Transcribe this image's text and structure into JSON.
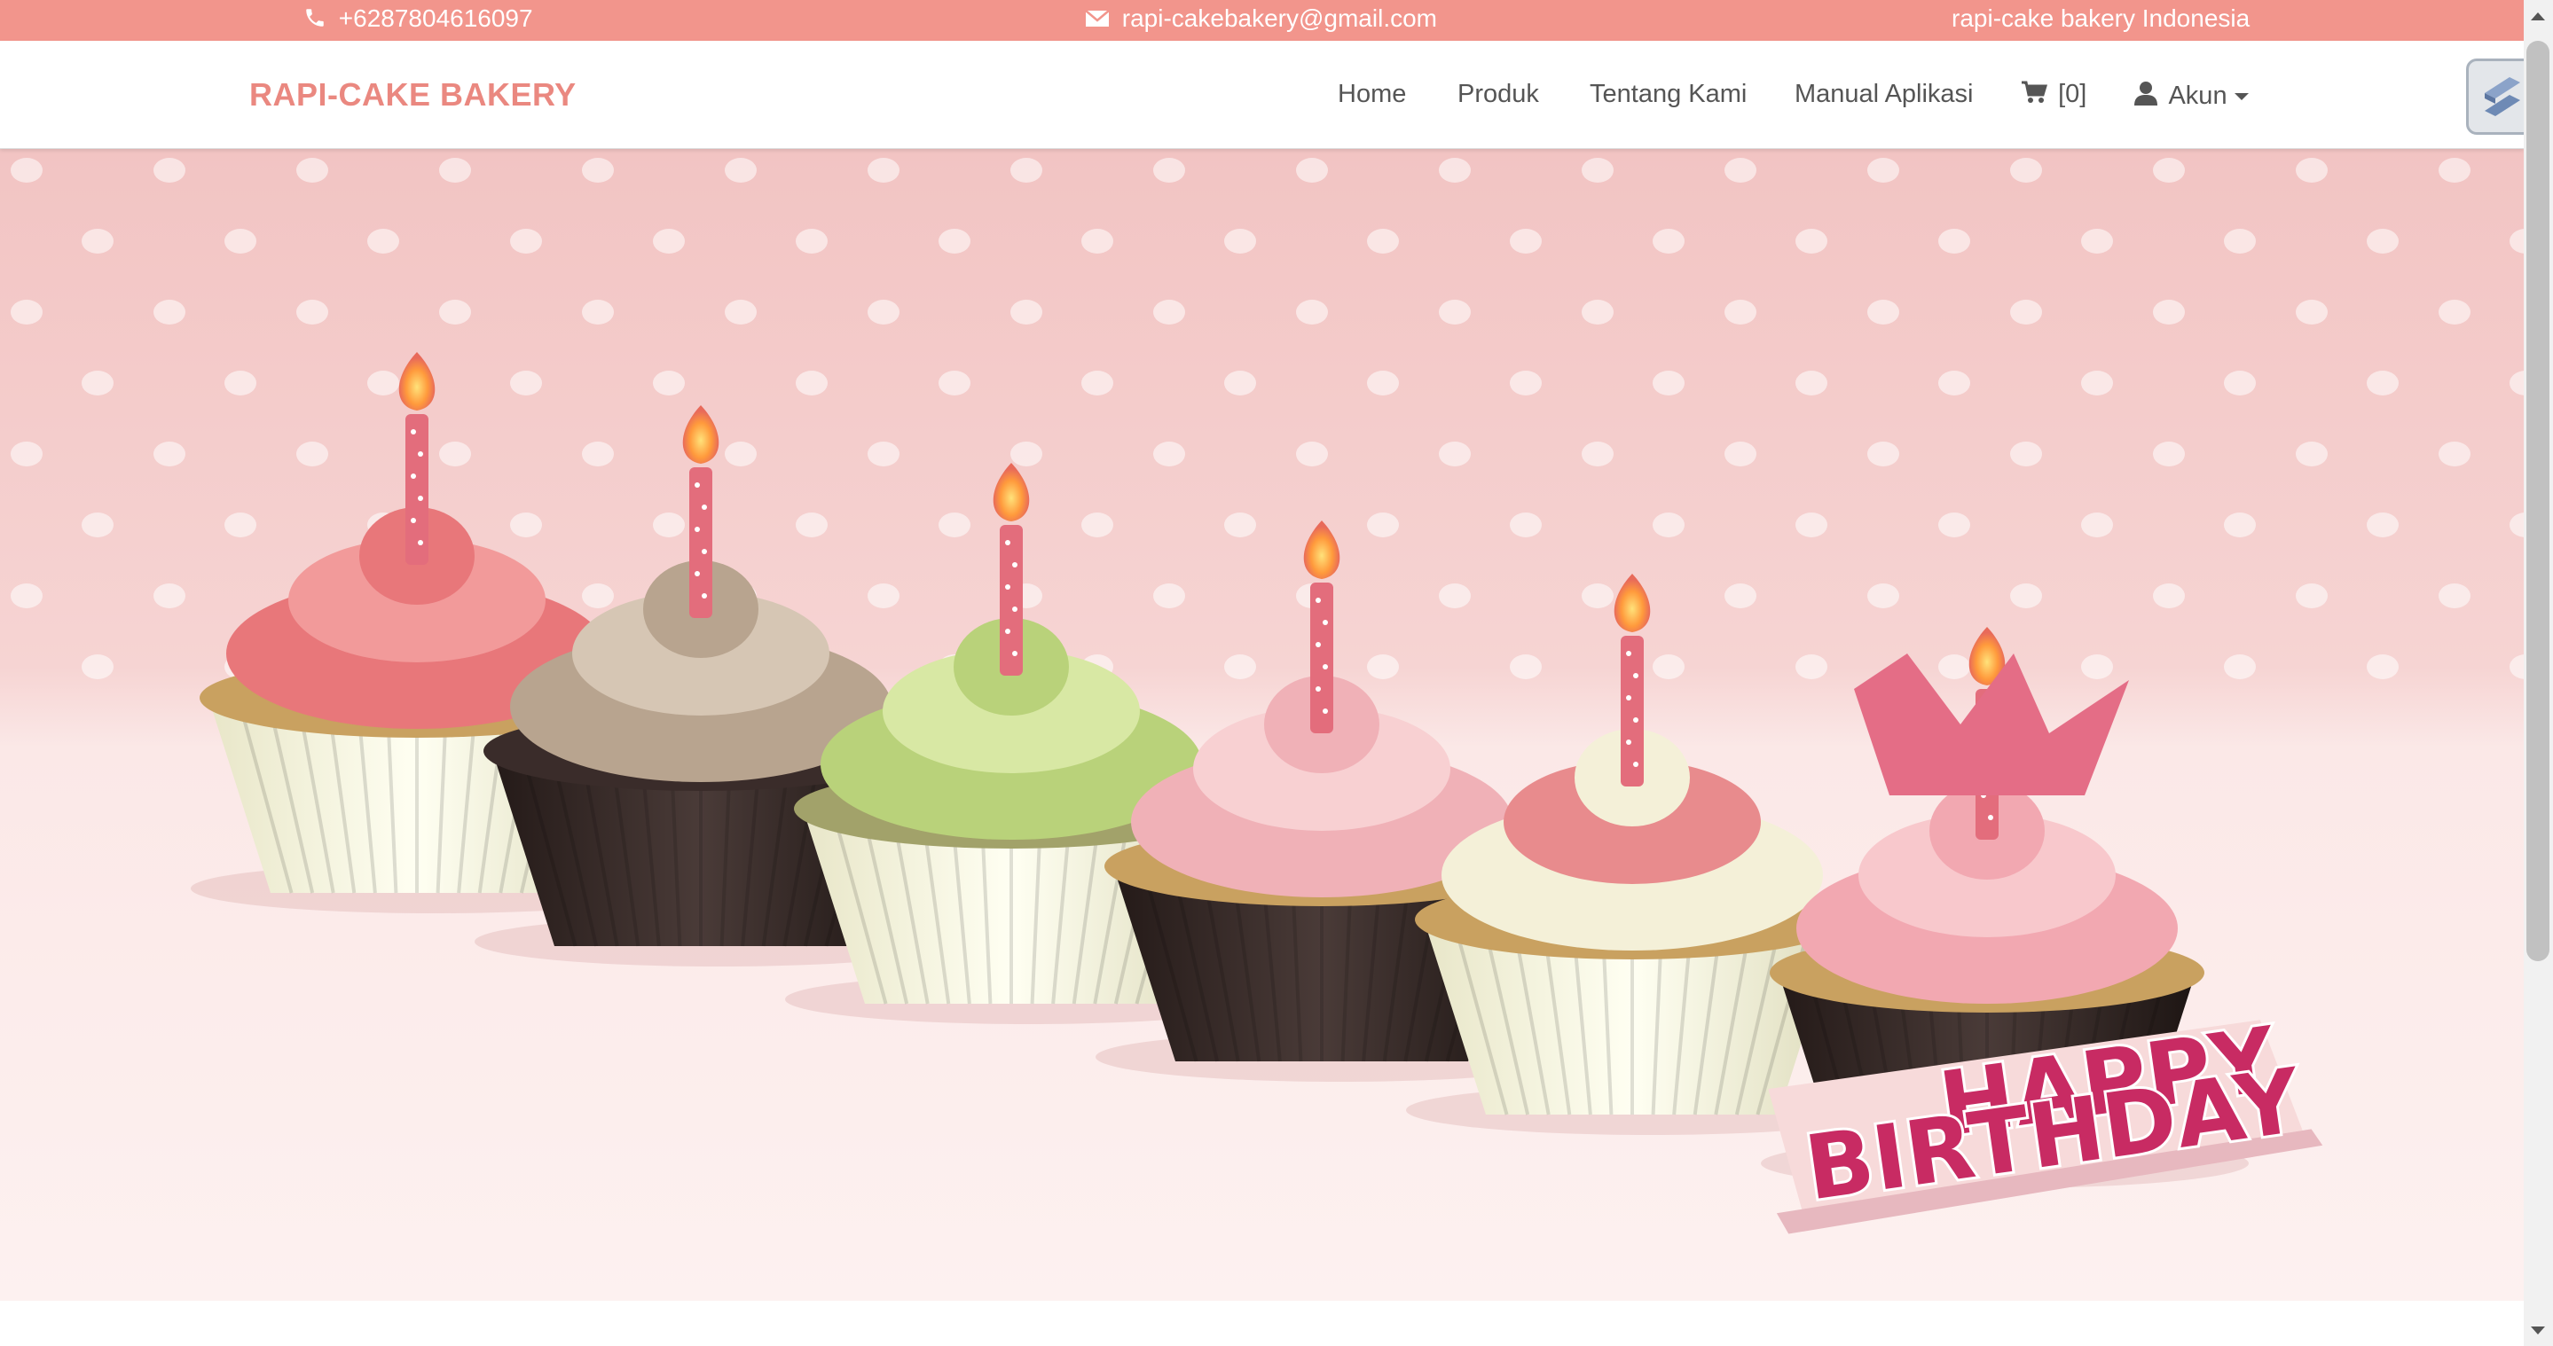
{
  "topbar": {
    "phone": "+6287804616097",
    "email": "rapi-cakebakery@gmail.com",
    "region": "rapi-cake bakery Indonesia",
    "background": "#f2958c"
  },
  "navbar": {
    "brand": "RAPI-CAKE BAKERY",
    "brand_color": "#ea8880",
    "links": [
      {
        "label": "Home"
      },
      {
        "label": "Produk"
      },
      {
        "label": "Tentang Kami"
      },
      {
        "label": "Manual Aplikasi"
      }
    ],
    "cart": {
      "label": "[0]",
      "icon": "cart-icon"
    },
    "account": {
      "label": "Akun",
      "icon": "user-icon"
    }
  },
  "hero": {
    "banner_text_line1": "HAPPY",
    "banner_text_line2": "BIRTHDAY",
    "cupcakes": 6
  }
}
